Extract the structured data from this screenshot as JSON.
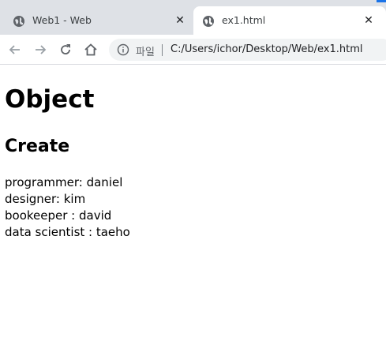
{
  "browser": {
    "tabs": [
      {
        "title": "Web1 - Web",
        "active": false,
        "close": "✕"
      },
      {
        "title": "ex1.html",
        "active": true,
        "close": "✕"
      }
    ],
    "address_bar": {
      "page_info_label": "파일",
      "url": "C:/Users/ichor/Desktop/Web/ex1.html"
    },
    "colors": {
      "tabstrip": "#dee1e6",
      "accent": "#1a73e8",
      "omnibox": "#f1f3f4"
    }
  },
  "page": {
    "heading": "Object",
    "subheading": "Create",
    "lines": [
      "programmer: daniel",
      "designer: kim",
      "bookeeper : david",
      "data scientist : taeho"
    ]
  }
}
